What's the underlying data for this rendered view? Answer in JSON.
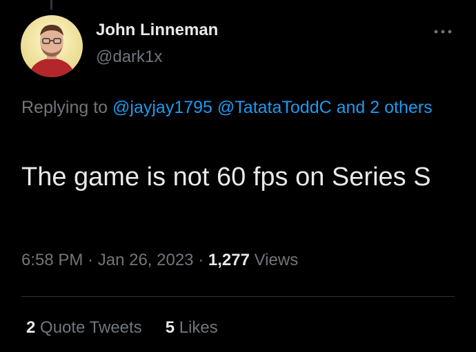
{
  "tweet": {
    "author": {
      "display_name": "John Linneman",
      "handle": "@dark1x",
      "avatar_icon": "profile-photo"
    },
    "more_icon": "more-horizontal-icon",
    "reply": {
      "prefix": "Replying to",
      "mentions": [
        "@jayjay1795",
        "@TatataToddC"
      ],
      "conjunction": "and",
      "others": "2 others"
    },
    "text": "The game is not 60 fps on Series S",
    "meta": {
      "time": "6:58 PM",
      "separator": "·",
      "date": "Jan 26, 2023",
      "views_count": "1,277",
      "views_label": "Views"
    },
    "stats": {
      "quote_tweets_count": "2",
      "quote_tweets_label": "Quote Tweets",
      "likes_count": "5",
      "likes_label": "Likes"
    }
  },
  "colors": {
    "background": "#000000",
    "primary_text": "#e7e9ea",
    "secondary_text": "#71767b",
    "link": "#1d9bf0",
    "divider": "#2f3336"
  }
}
